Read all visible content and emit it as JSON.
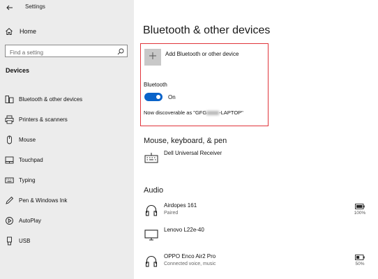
{
  "app": {
    "title": "Settings"
  },
  "sidebar": {
    "home_label": "Home",
    "search_placeholder": "Find a setting",
    "section_label": "Devices",
    "items": [
      {
        "label": "Bluetooth & other devices",
        "icon": "bluetooth-devices-icon"
      },
      {
        "label": "Printers & scanners",
        "icon": "printer-icon"
      },
      {
        "label": "Mouse",
        "icon": "mouse-icon"
      },
      {
        "label": "Touchpad",
        "icon": "touchpad-icon"
      },
      {
        "label": "Typing",
        "icon": "keyboard-icon"
      },
      {
        "label": "Pen & Windows Ink",
        "icon": "pen-icon"
      },
      {
        "label": "AutoPlay",
        "icon": "autoplay-icon"
      },
      {
        "label": "USB",
        "icon": "usb-icon"
      }
    ]
  },
  "main": {
    "title": "Bluetooth & other devices",
    "add_device_label": "Add Bluetooth or other device",
    "bluetooth": {
      "label": "Bluetooth",
      "state": "On",
      "toggle_on": true,
      "discoverable_prefix": "Now discoverable as \"GFG",
      "discoverable_suffix": "-LAPTOP\""
    },
    "mouse_section": {
      "title": "Mouse, keyboard, & pen",
      "devices": [
        {
          "name": "Dell Universal Receiver",
          "icon": "keyboard-icon"
        }
      ]
    },
    "audio_section": {
      "title": "Audio",
      "devices": [
        {
          "name": "Airdopes 161",
          "status": "Paired",
          "battery": "100%",
          "icon": "headphones-icon"
        },
        {
          "name": "Lenovo L22e-40",
          "icon": "monitor-icon"
        },
        {
          "name": "OPPO Enco Air2 Pro",
          "status": "Connected voice, music",
          "battery": "50%",
          "icon": "headphones-icon"
        }
      ]
    }
  },
  "colors": {
    "accent": "#0a63c9",
    "highlight_border": "#e0343a",
    "sidebar_bg": "#ececec"
  }
}
